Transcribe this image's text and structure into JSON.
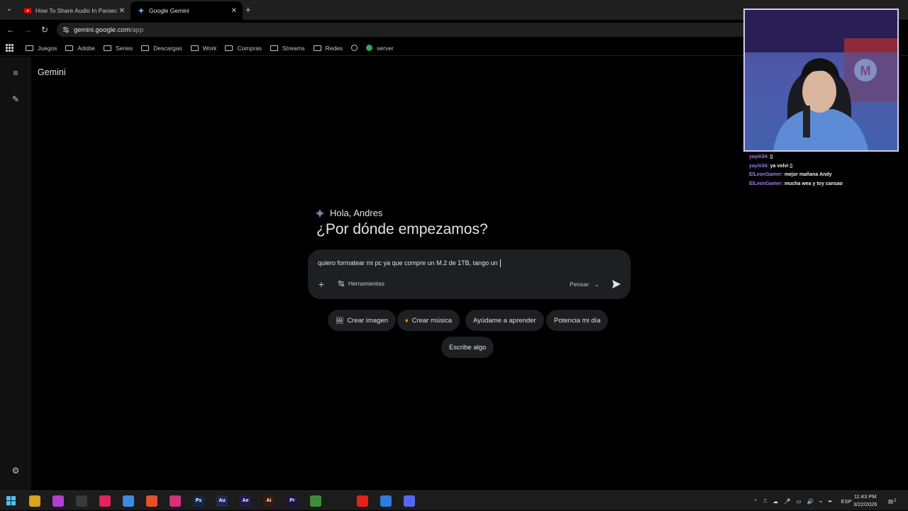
{
  "browser": {
    "tabs": [
      {
        "title": "How To Share Audio In Parsec",
        "active": false
      },
      {
        "title": "Google Gemini",
        "active": true
      }
    ],
    "address": {
      "host": "gemini.google.com",
      "path": "/app"
    },
    "bookmarks": [
      "Juegos",
      "Adobe",
      "Series",
      "Descargas",
      "Work",
      "Compras",
      "Streams",
      "Redes",
      "",
      "server"
    ]
  },
  "app": {
    "title": "Gemini",
    "greeting": "Hola, Andres",
    "heading": "¿Por dónde empezamos?",
    "prompt_value": "quiero formatear mi pc ya que compre un M.2 de 1TB, tango un",
    "tools_label": "Herramientas",
    "model_label": "Pensar",
    "chips": [
      {
        "label": "Crear imagen",
        "icon": "image-icon"
      },
      {
        "label": "Crear música",
        "icon": "music-icon"
      },
      {
        "label": "Ayúdame a aprender",
        "icon": ""
      },
      {
        "label": "Potencia mi día",
        "icon": ""
      },
      {
        "label": "Escribe algo",
        "icon": ""
      }
    ]
  },
  "stream_chat": [
    {
      "user": "yayiii34:",
      "msg": "▯"
    },
    {
      "user": "yayiii34:",
      "msg": "ya volvi ▯"
    },
    {
      "user": "ElLeonGamer:",
      "msg": "mejor mañana Andy"
    },
    {
      "user": "ElLeonGamer:",
      "msg": "mucha wea y toy cansao"
    }
  ],
  "taskbar": {
    "language": "ESP",
    "time": "11:43 PM",
    "date": "3/22/2026",
    "notification_count": "2",
    "apps": [
      {
        "name": "file-explorer-icon",
        "label": "",
        "color": "#d9a21f"
      },
      {
        "name": "instagram-icon",
        "label": "",
        "color": "#b23fd1"
      },
      {
        "name": "obs-icon",
        "label": "",
        "color": "#3a3a3a"
      },
      {
        "name": "tiktok-icon",
        "label": "",
        "color": "#e0245e"
      },
      {
        "name": "copilot-icon",
        "label": "",
        "color": "#3d8be0"
      },
      {
        "name": "brave-icon",
        "label": "",
        "color": "#e5512b"
      },
      {
        "name": "instagram-icon-2",
        "label": "",
        "color": "#d6317c"
      },
      {
        "name": "photoshop-icon",
        "label": "Ps",
        "color": "#0f2a4a"
      },
      {
        "name": "audition-icon",
        "label": "Au",
        "color": "#1f2a55"
      },
      {
        "name": "after-effects-icon",
        "label": "Ae",
        "color": "#241a4d"
      },
      {
        "name": "illustrator-icon",
        "label": "Ai",
        "color": "#3a1a0a"
      },
      {
        "name": "premiere-icon",
        "label": "Pr",
        "color": "#1d1446"
      },
      {
        "name": "minecraft-icon",
        "label": "",
        "color": "#3f8b3a"
      },
      {
        "name": "netflix-icon",
        "label": "",
        "color": "#1c1c1c"
      },
      {
        "name": "youtube-icon",
        "label": "",
        "color": "#e62117"
      },
      {
        "name": "chrome-icon",
        "label": "",
        "color": "#2a7de1"
      },
      {
        "name": "discord-icon",
        "label": "",
        "color": "#5865f2"
      }
    ]
  }
}
